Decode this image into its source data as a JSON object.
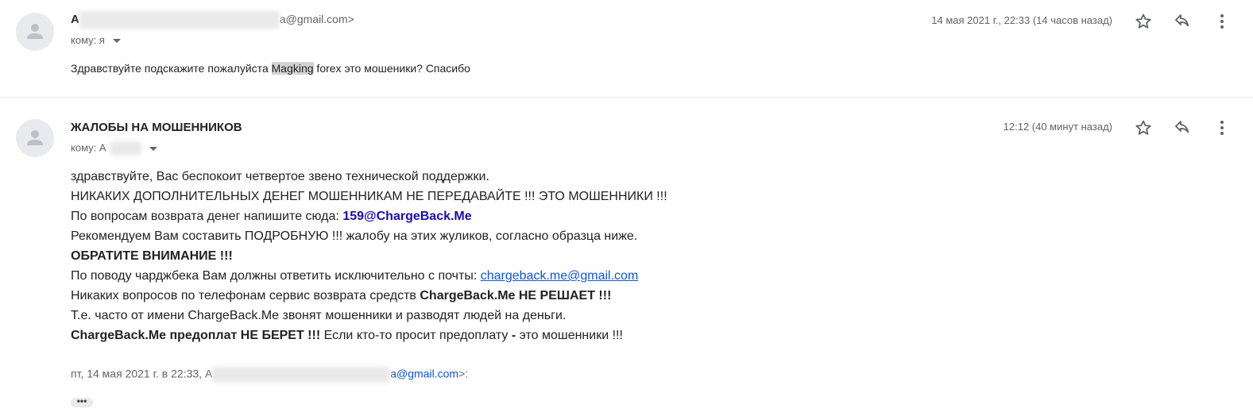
{
  "message1": {
    "sender_initial": "А",
    "sender_address_tail": "a@gmail.com>",
    "to_label": "кому: я",
    "date": "14 мая 2021 г., 22:33 (14 часов назад)",
    "snippet_before": "Здравствуйте подскажите пожалуйста ",
    "snippet_highlight": "Magking",
    "snippet_after": " forex это мошеники? Спасибо"
  },
  "message2": {
    "sender_name": "ЖАЛОБЫ НА МОШЕННИКОВ",
    "to_label": "кому: А",
    "date": "12:12 (40 минут назад)",
    "lines": {
      "l1": "здравствуйте, Вас беспокоит четвертое звено технической поддержки.",
      "l2": "НИКАКИХ ДОПОЛНИТЕЛЬНЫХ ДЕНЕГ МОШЕННИКАМ НЕ ПЕРЕДАВАЙТЕ !!! ЭТО МОШЕННИКИ !!!",
      "l3_text": "По вопросам возврата денег напишите сюда: ",
      "l3_email": "159@ChargeBack.Me",
      "l4": "Рекомендуем Вам составить ПОДРОБНУЮ !!! жалобу на этих жуликов, согласно образца ниже.",
      "l5": "ОБРАТИТЕ ВНИМАНИЕ !!!",
      "l6_text": "По поводу чарджбека Вам должны ответить исключительно с почты: ",
      "l6_link": "chargeback.me@gmail.com",
      "l7_text": "Никаких вопросов по телефонам сервис возврата средств ",
      "l7_bold": "ChargeBack.Me НЕ РЕШАЕТ !!!",
      "l8": "Т.е. часто от имени ChargeBack.Me звонят мошенники и разводят людей на деньги.",
      "l9_bold": "ChargeBack.Me предоплат НЕ БЕРЕТ !!!",
      "l9_text": " Если кто-то просит предоплату ",
      "l9_dash": "-",
      "l9_end": " это мошенники !!!"
    },
    "quote_prefix": "пт, 14 мая 2021 г. в 22:33, А",
    "quote_email_tail": "a@gmail.com",
    "quote_suffix": ">:",
    "ellipsis": "•••"
  },
  "icons": {
    "star": "star-icon",
    "reply": "reply-icon",
    "more": "more-vert-icon",
    "avatar": "person-avatar-icon"
  },
  "colors": {
    "link": "#1155cc",
    "blue_email": "#1a0dab",
    "meta": "#5f6368"
  }
}
